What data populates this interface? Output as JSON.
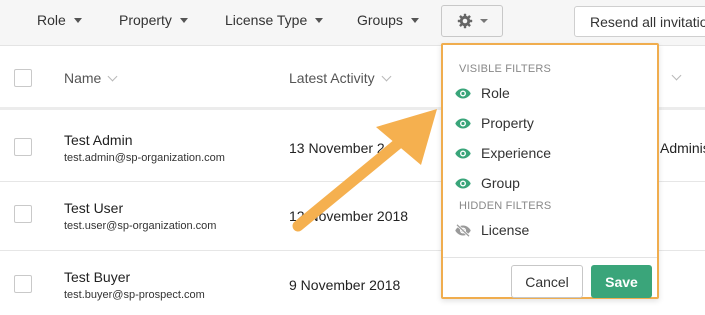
{
  "filter_bar": {
    "filters": [
      {
        "label": "Role"
      },
      {
        "label": "Property"
      },
      {
        "label": "License Type"
      },
      {
        "label": "Groups"
      }
    ],
    "settings_icon": "gear-icon",
    "resend_label": "Resend all invitations"
  },
  "table": {
    "columns": [
      {
        "label": "Name"
      },
      {
        "label": "Latest Activity"
      }
    ],
    "rows": [
      {
        "name": "Test Admin",
        "email": "test.admin@sp-organization.com",
        "activity": "13 November 2",
        "role": "Administrato"
      },
      {
        "name": "Test User",
        "email": "test.user@sp-organization.com",
        "activity": "12 November 2018",
        "role": ""
      },
      {
        "name": "Test Buyer",
        "email": "test.buyer@sp-prospect.com",
        "activity": "9 November 2018",
        "role": ""
      }
    ]
  },
  "dropdown": {
    "visible_title": "VISIBLE FILTERS",
    "visible_items": [
      {
        "label": "Role",
        "icon": "eye-icon"
      },
      {
        "label": "Property",
        "icon": "eye-icon"
      },
      {
        "label": "Experience",
        "icon": "eye-icon"
      },
      {
        "label": "Group",
        "icon": "eye-icon"
      }
    ],
    "hidden_title": "HIDDEN FILTERS",
    "hidden_items": [
      {
        "label": "License",
        "icon": "eye-slash-icon"
      }
    ],
    "cancel_label": "Cancel",
    "save_label": "Save"
  },
  "colors": {
    "highlight": "#f0ad4e",
    "arrow": "#f5b04f",
    "eye_icon": "#3aa57a",
    "save_button": "#3aa57a"
  }
}
